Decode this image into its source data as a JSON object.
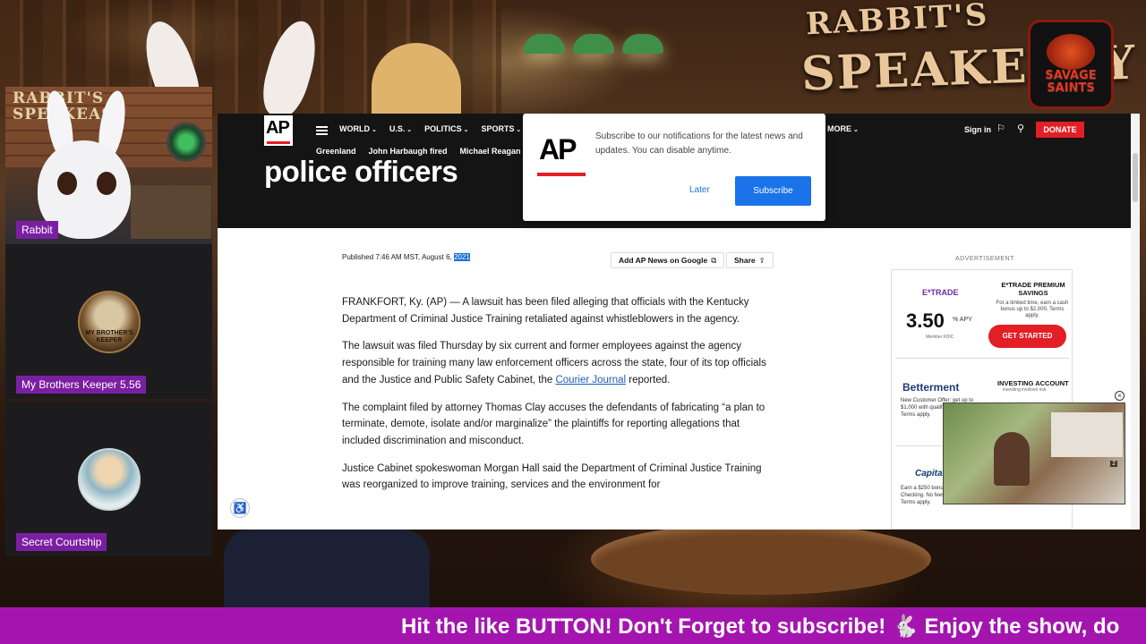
{
  "stream": {
    "logo": {
      "line1": "SAVAGE",
      "line2": "SAINTS"
    },
    "background_sign": {
      "line1": "RABBIT'S",
      "line2": "SPEAKEASY"
    },
    "participants": [
      {
        "name": "Rabbit",
        "sign": "RABBIT'S SPEAKEASY"
      },
      {
        "name": "My Brothers Keeper 5.56",
        "avatar_text": "MY BROTHER'S KEEPER"
      },
      {
        "name": "Secret Courtship"
      }
    ],
    "ticker": "Hit the like BUTTON! Don't Forget to subscribe! 🐇 Enjoy the show, do"
  },
  "ap": {
    "logo": "AP",
    "nav": [
      "WORLD",
      "U.S.",
      "POLITICS",
      "SPORTS"
    ],
    "more": "MORE",
    "trending": [
      "Greenland",
      "John Harbaugh fired",
      "Michael Reagan dies"
    ],
    "signin": "Sign in",
    "donate": "DONATE",
    "headline": "police officers",
    "published_prefix": "Published 7:46 AM MST, August 6, ",
    "published_year": "2021",
    "add_google": "Add AP News on Google",
    "share": "Share",
    "article": {
      "p1": "FRANKFORT, Ky. (AP) — A lawsuit has been filed alleging that officials with the Kentucky Department of Criminal Justice Training retaliated against whistleblowers in the agency.",
      "p2_before": "The lawsuit was filed Thursday by six current and former employees against the agency responsible for training many law enforcement officers across the state, four of its top officials and the Justice and Public Safety Cabinet, the ",
      "p2_link": "Courier Journal",
      "p2_after": " reported.",
      "p3": "The complaint filed by attorney Thomas Clay accuses the defendants of fabricating “a plan to terminate, demote, isolate and/or marginalize” the plaintiffs for reporting allegations that included discrimination and misconduct.",
      "p4": "Justice Cabinet spokeswoman Morgan Hall said the Department of Criminal Justice Training was reorganized to improve training, services and the environment for"
    },
    "popup": {
      "message": "Subscribe to our notifications for the latest news and updates. You can disable anytime.",
      "later": "Later",
      "subscribe": "Subscribe"
    },
    "ad": {
      "label": "ADVERTISEMENT",
      "etrade": "E*TRADE",
      "rate": "3.50",
      "apy": "% APY",
      "fdic": "Member FDIC",
      "promo_title": "E*TRADE PREMIUM SAVINGS",
      "promo_sub": "For a limited time, earn a cash bonus up to $2,000. Terms apply.",
      "cta": "GET STARTED",
      "betterment": "Betterment",
      "betterment_desc": "New Customer Offer: get up to $1,000 with qualifying deposit. Terms apply.",
      "investing_title": "INVESTING ACCOUNT",
      "investing_sub": "investing involves risk",
      "capital": "Capital One",
      "capital_desc": "Earn a $250 bonus with 360 Checking. No fees or minimums. Terms apply."
    },
    "video_badge": "2"
  }
}
